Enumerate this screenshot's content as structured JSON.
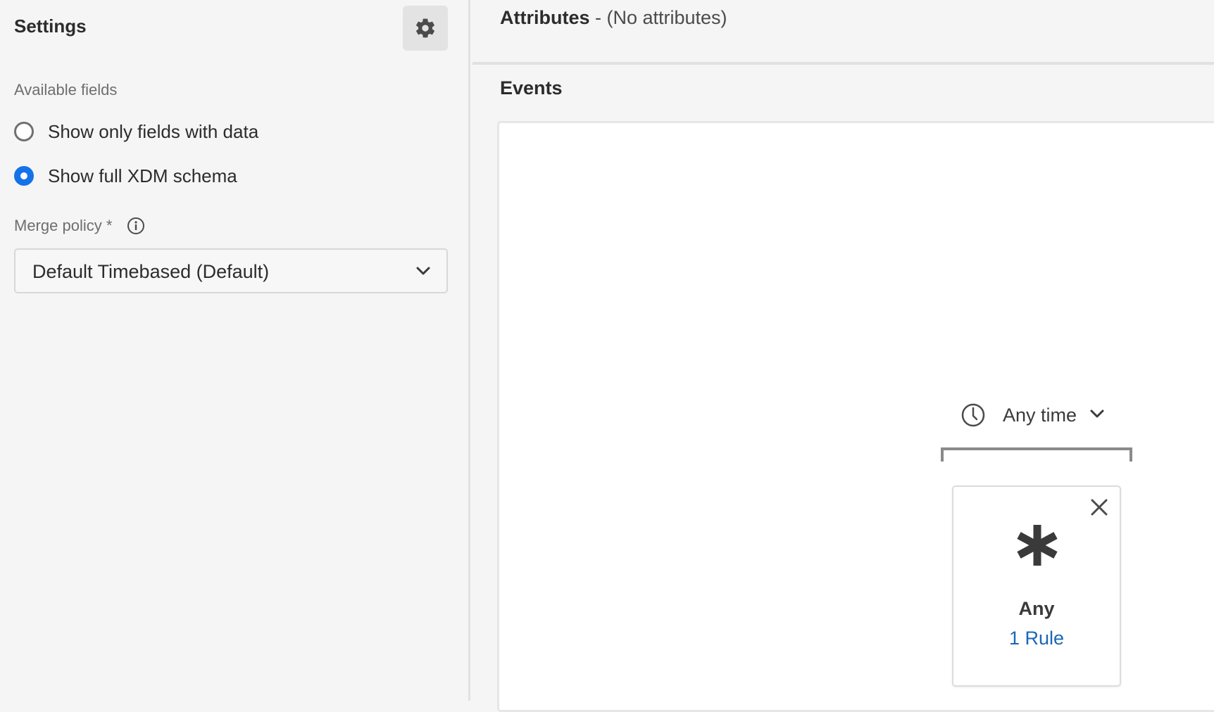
{
  "settings": {
    "title": "Settings",
    "gear_icon": "gear-icon",
    "available_fields_label": "Available fields",
    "radio_options": [
      {
        "label": "Show only fields with data",
        "checked": false
      },
      {
        "label": "Show full XDM schema",
        "checked": true
      }
    ],
    "merge_policy_label": "Merge policy *",
    "merge_policy_value": "Default Timebased (Default)"
  },
  "attributes": {
    "title": "Attributes",
    "subtitle": " - (No attributes)"
  },
  "events": {
    "title": "Events",
    "time_selector": {
      "icon": "clock-icon",
      "label": "Any time"
    },
    "rule_card": {
      "icon": "asterisk-icon",
      "title": "Any",
      "link": "1 Rule"
    }
  },
  "colors": {
    "accent": "#1473e6",
    "link": "#1a67b8"
  }
}
